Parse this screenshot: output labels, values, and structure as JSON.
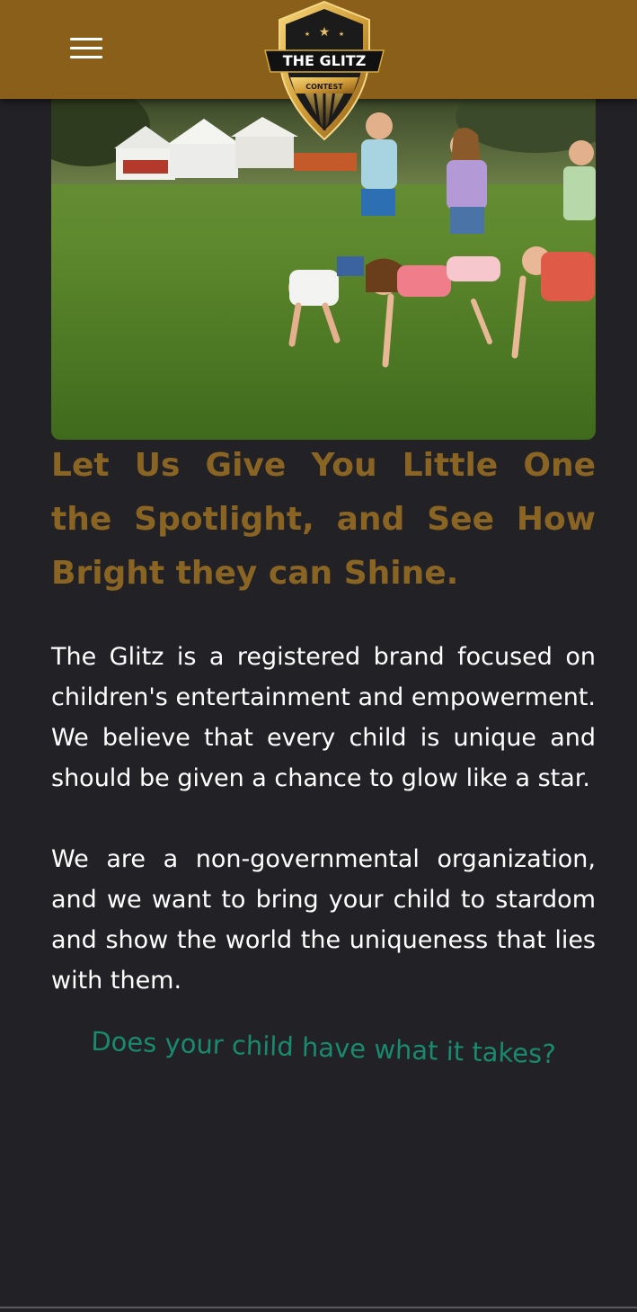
{
  "header": {
    "menu_icon": "hamburger-menu-icon",
    "logo": {
      "icon": "shield-logo-icon",
      "title": "THE GLITZ",
      "subtitle": "CONTEST"
    },
    "background": "#8a5f1a"
  },
  "hero": {
    "image": "children-playing-on-grass-photo"
  },
  "main": {
    "heading": "Let Us Give You Little One the Spotlight, and See How Bright they can Shine.",
    "paragraph_1": "The Glitz is a registered brand focused on children's entertainment and empowerment. We believe that every child is unique and should be given a chance to glow like a star.",
    "paragraph_2": "We are a non-governmental organization, and we want to bring your child to stardom and show the world the uniqueness that lies with them.",
    "tagline": "Does your child have what it takes?"
  },
  "colors": {
    "background": "#222126",
    "heading": "#8a6423",
    "body_text": "#ffffff",
    "tagline": "#1a8a6e",
    "gold": "#d4a93a"
  }
}
